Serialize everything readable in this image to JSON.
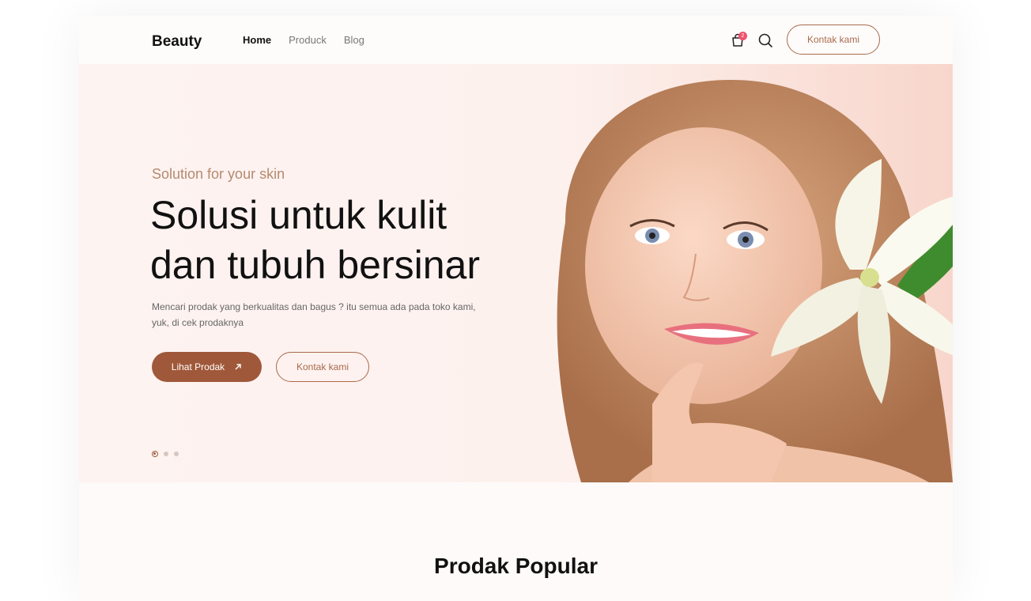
{
  "header": {
    "logo": "Beauty",
    "nav": [
      {
        "label": "Home",
        "active": true
      },
      {
        "label": "Produck",
        "active": false
      },
      {
        "label": "Blog",
        "active": false
      }
    ],
    "cart_count": "2",
    "contact_label": "Kontak kami",
    "icons": [
      "shopping-bag-icon",
      "search-icon"
    ]
  },
  "hero": {
    "subtitle": "Solution for your skin",
    "headline_line1": "Solusi untuk kulit",
    "headline_line2": "dan tubuh bersinar",
    "description": "Mencari prodak yang berkualitas dan bagus ? itu semua ada pada toko kami, yuk, di cek prodaknya",
    "primary_button": "Lihat Prodak",
    "secondary_button": "Kontak kami",
    "slides_total": 3,
    "active_slide": 1
  },
  "section": {
    "title": "Prodak Popular"
  },
  "colors": {
    "accent": "#a0583a",
    "accent_light": "#b58a6e",
    "hero_bg": "#fdf3f1",
    "badge": "#f0506e"
  }
}
